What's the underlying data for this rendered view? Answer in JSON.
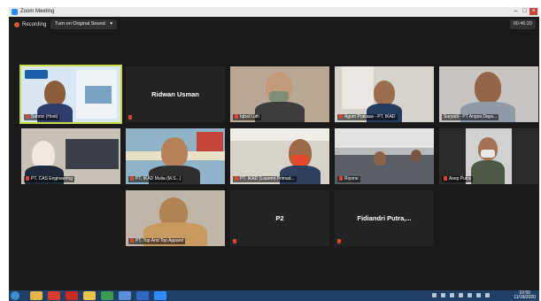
{
  "window": {
    "title": "Zoom Meeting",
    "controls": [
      "minimize-icon",
      "maximize-icon",
      "close-icon"
    ]
  },
  "toolbar": {
    "recording_label": "Recording",
    "sound_button": "Turn on Original Sound",
    "sound_chevron": "▾",
    "timer": "00:46:20"
  },
  "participants": [
    {
      "name": "Sahrizi (Host)",
      "video": true,
      "active": true,
      "muted": true
    },
    {
      "name": "Ridwan Usman",
      "video": false,
      "muted": true
    },
    {
      "name": "Iqbal Lutfi",
      "video": true,
      "muted": true
    },
    {
      "name": "Agum Prakasa - PT. IKAD",
      "video": true,
      "muted": true
    },
    {
      "name": "Suryadi - PT Angsa Daya...",
      "video": true,
      "muted": false
    },
    {
      "name": "PT. CAS Engineering",
      "video": true,
      "muted": true
    },
    {
      "name": "PT. IKAD Mulia (M.S...)",
      "video": true,
      "muted": true
    },
    {
      "name": "PT. IKAD (Laurent Primad...",
      "video": true,
      "muted": true
    },
    {
      "name": "Riyono",
      "video": true,
      "muted": true
    },
    {
      "name": "Asep Putra",
      "video": true,
      "muted": true
    },
    {
      "name": "PT. Top And Top Apparel",
      "video": true,
      "muted": true
    },
    {
      "name": "P2",
      "video": false,
      "muted": true
    },
    {
      "name": "Fidiandri  Putra,...",
      "video": false,
      "muted": true
    }
  ],
  "taskbar": {
    "time": "10:50",
    "date": "11/18/2020"
  },
  "colors": {
    "meeting_bg": "#1a1a1a",
    "tile_bg": "#232323",
    "active_outline": "#c8d94a",
    "muted_icon": "#e0442f",
    "taskbar": "#1f4168"
  }
}
